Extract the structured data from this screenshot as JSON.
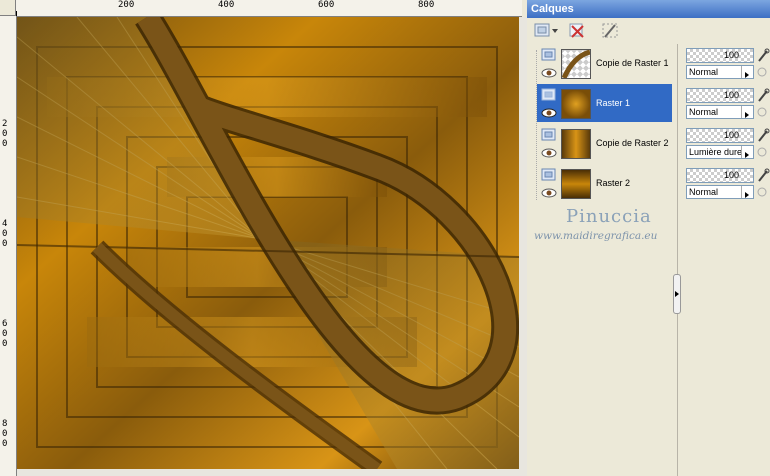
{
  "rulers": {
    "horizontal_labels": [
      "200",
      "400",
      "600",
      "800"
    ],
    "vertical_labels": [
      "2",
      "0",
      "0",
      "4",
      "0",
      "0",
      "6",
      "0",
      "0",
      "8",
      "0",
      "0"
    ]
  },
  "palette": {
    "title": "Calques",
    "layers": [
      {
        "name": "Copie de Raster 1",
        "selected": false,
        "opacity": "100",
        "blend": "Normal"
      },
      {
        "name": "Raster 1",
        "selected": true,
        "opacity": "100",
        "blend": "Normal"
      },
      {
        "name": "Copie de Raster 2",
        "selected": false,
        "opacity": "100",
        "blend": "Lumière dure"
      },
      {
        "name": "Raster 2",
        "selected": false,
        "opacity": "100",
        "blend": "Normal"
      }
    ]
  },
  "watermark": {
    "name": "Pinuccia",
    "url": "www.maidiregrafica.eu"
  },
  "colors": {
    "title_bar": "#3d6fc4",
    "selection": "#316ac5",
    "canvas_dark": "#5a3a0a",
    "canvas_gold": "#c8860a"
  }
}
